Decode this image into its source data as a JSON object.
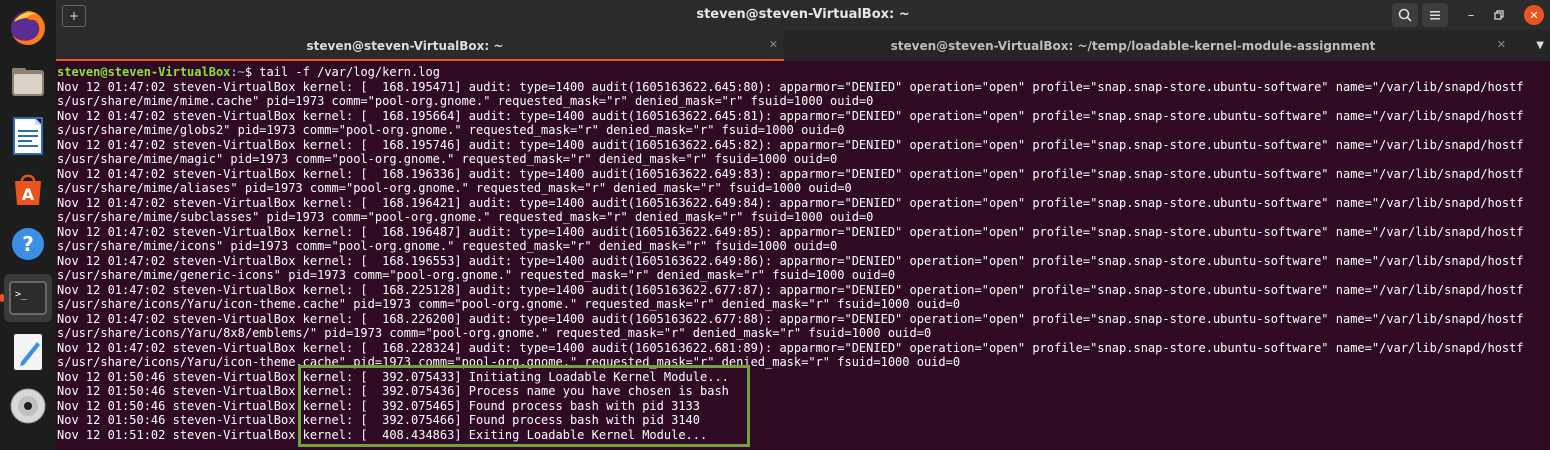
{
  "window": {
    "title": "steven@steven-VirtualBox: ~"
  },
  "tabs": [
    {
      "label": "steven@steven-VirtualBox: ~",
      "active": true
    },
    {
      "label": "steven@steven-VirtualBox: ~/temp/loadable-kernel-module-assignment",
      "active": false
    }
  ],
  "terminal": {
    "prompt_user": "steven@steven-VirtualBox",
    "prompt_path": ":~",
    "prompt_symbol": "$ ",
    "command": "tail -f /var/log/kern.log",
    "lines": [
      "Nov 12 01:47:02 steven-VirtualBox kernel: [  168.195471] audit: type=1400 audit(1605163622.645:80): apparmor=\"DENIED\" operation=\"open\" profile=\"snap.snap-store.ubuntu-software\" name=\"/var/lib/snapd/hostf",
      "s/usr/share/mime/mime.cache\" pid=1973 comm=\"pool-org.gnome.\" requested_mask=\"r\" denied_mask=\"r\" fsuid=1000 ouid=0",
      "Nov 12 01:47:02 steven-VirtualBox kernel: [  168.195664] audit: type=1400 audit(1605163622.645:81): apparmor=\"DENIED\" operation=\"open\" profile=\"snap.snap-store.ubuntu-software\" name=\"/var/lib/snapd/hostf",
      "s/usr/share/mime/globs2\" pid=1973 comm=\"pool-org.gnome.\" requested_mask=\"r\" denied_mask=\"r\" fsuid=1000 ouid=0",
      "Nov 12 01:47:02 steven-VirtualBox kernel: [  168.195746] audit: type=1400 audit(1605163622.645:82): apparmor=\"DENIED\" operation=\"open\" profile=\"snap.snap-store.ubuntu-software\" name=\"/var/lib/snapd/hostf",
      "s/usr/share/mime/magic\" pid=1973 comm=\"pool-org.gnome.\" requested_mask=\"r\" denied_mask=\"r\" fsuid=1000 ouid=0",
      "Nov 12 01:47:02 steven-VirtualBox kernel: [  168.196336] audit: type=1400 audit(1605163622.649:83): apparmor=\"DENIED\" operation=\"open\" profile=\"snap.snap-store.ubuntu-software\" name=\"/var/lib/snapd/hostf",
      "s/usr/share/mime/aliases\" pid=1973 comm=\"pool-org.gnome.\" requested_mask=\"r\" denied_mask=\"r\" fsuid=1000 ouid=0",
      "Nov 12 01:47:02 steven-VirtualBox kernel: [  168.196421] audit: type=1400 audit(1605163622.649:84): apparmor=\"DENIED\" operation=\"open\" profile=\"snap.snap-store.ubuntu-software\" name=\"/var/lib/snapd/hostf",
      "s/usr/share/mime/subclasses\" pid=1973 comm=\"pool-org.gnome.\" requested_mask=\"r\" denied_mask=\"r\" fsuid=1000 ouid=0",
      "Nov 12 01:47:02 steven-VirtualBox kernel: [  168.196487] audit: type=1400 audit(1605163622.649:85): apparmor=\"DENIED\" operation=\"open\" profile=\"snap.snap-store.ubuntu-software\" name=\"/var/lib/snapd/hostf",
      "s/usr/share/mime/icons\" pid=1973 comm=\"pool-org.gnome.\" requested_mask=\"r\" denied_mask=\"r\" fsuid=1000 ouid=0",
      "Nov 12 01:47:02 steven-VirtualBox kernel: [  168.196553] audit: type=1400 audit(1605163622.649:86): apparmor=\"DENIED\" operation=\"open\" profile=\"snap.snap-store.ubuntu-software\" name=\"/var/lib/snapd/hostf",
      "s/usr/share/mime/generic-icons\" pid=1973 comm=\"pool-org.gnome.\" requested_mask=\"r\" denied_mask=\"r\" fsuid=1000 ouid=0",
      "Nov 12 01:47:02 steven-VirtualBox kernel: [  168.225128] audit: type=1400 audit(1605163622.677:87): apparmor=\"DENIED\" operation=\"open\" profile=\"snap.snap-store.ubuntu-software\" name=\"/var/lib/snapd/hostf",
      "s/usr/share/icons/Yaru/icon-theme.cache\" pid=1973 comm=\"pool-org.gnome.\" requested_mask=\"r\" denied_mask=\"r\" fsuid=1000 ouid=0",
      "Nov 12 01:47:02 steven-VirtualBox kernel: [  168.226200] audit: type=1400 audit(1605163622.677:88): apparmor=\"DENIED\" operation=\"open\" profile=\"snap.snap-store.ubuntu-software\" name=\"/var/lib/snapd/hostf",
      "s/usr/share/icons/Yaru/8x8/emblems/\" pid=1973 comm=\"pool-org.gnome.\" requested_mask=\"r\" denied_mask=\"r\" fsuid=1000 ouid=0",
      "Nov 12 01:47:02 steven-VirtualBox kernel: [  168.228324] audit: type=1400 audit(1605163622.681:89): apparmor=\"DENIED\" operation=\"open\" profile=\"snap.snap-store.ubuntu-software\" name=\"/var/lib/snapd/hostf",
      "s/usr/share/icons/Yaru/icon-theme.cache\" pid=1973 comm=\"pool-org.gnome.\" requested_mask=\"r\" denied_mask=\"r\" fsuid=1000 ouid=0",
      "Nov 12 01:50:46 steven-VirtualBox kernel: [  392.075433] Initiating Loadable Kernel Module...",
      "Nov 12 01:50:46 steven-VirtualBox kernel: [  392.075436] Process name you have chosen is bash",
      "Nov 12 01:50:46 steven-VirtualBox kernel: [  392.075465] Found process bash with pid 3133",
      "Nov 12 01:50:46 steven-VirtualBox kernel: [  392.075466] Found process bash with pid 3140",
      "Nov 12 01:51:02 steven-VirtualBox kernel: [  408.434863] Exiting Loadable Kernel Module..."
    ]
  },
  "dock": [
    {
      "icon": "firefox-icon"
    },
    {
      "icon": "files-icon"
    },
    {
      "icon": "libreoffice-writer-icon"
    },
    {
      "icon": "software-center-icon"
    },
    {
      "icon": "help-icon"
    },
    {
      "icon": "terminal-icon",
      "active": true
    },
    {
      "icon": "text-editor-icon"
    },
    {
      "icon": "disc-icon"
    }
  ],
  "colors": {
    "terminal_bg": "#300a24",
    "prompt_user": "#8ae234",
    "prompt_path": "#729fcf",
    "accent": "#e95420",
    "highlight_box": "#6fa03a"
  }
}
